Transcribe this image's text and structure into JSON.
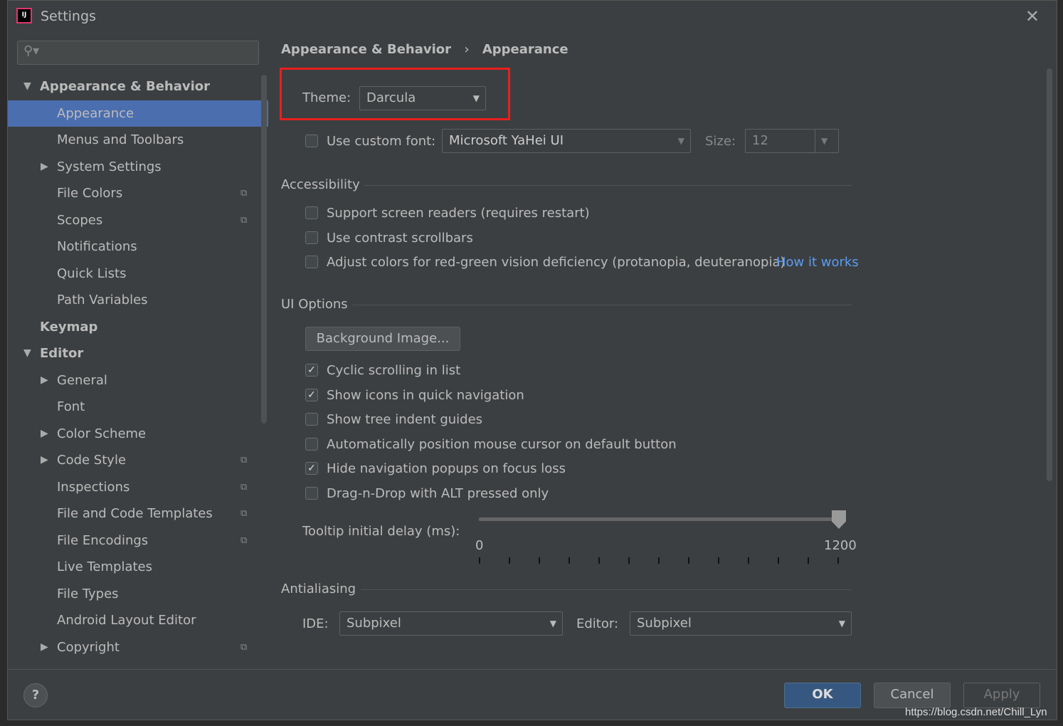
{
  "window": {
    "title": "Settings",
    "logo_text": "IJ",
    "close_icon": "close-icon"
  },
  "sidebar": {
    "search_placeholder": "",
    "items": [
      {
        "label": "Appearance & Behavior",
        "level": 0,
        "bold": true,
        "expanded": true
      },
      {
        "label": "Appearance",
        "level": 1,
        "selected": true
      },
      {
        "label": "Menus and Toolbars",
        "level": 1
      },
      {
        "label": "System Settings",
        "level": 1,
        "collapsed": true
      },
      {
        "label": "File Colors",
        "level": 1,
        "copy": true
      },
      {
        "label": "Scopes",
        "level": 1,
        "copy": true
      },
      {
        "label": "Notifications",
        "level": 1
      },
      {
        "label": "Quick Lists",
        "level": 1
      },
      {
        "label": "Path Variables",
        "level": 1
      },
      {
        "label": "Keymap",
        "level": 0,
        "bold": true
      },
      {
        "label": "Editor",
        "level": 0,
        "bold": true,
        "expanded": true
      },
      {
        "label": "General",
        "level": 1,
        "collapsed": true
      },
      {
        "label": "Font",
        "level": 1
      },
      {
        "label": "Color Scheme",
        "level": 1,
        "collapsed": true
      },
      {
        "label": "Code Style",
        "level": 1,
        "collapsed": true,
        "copy": true
      },
      {
        "label": "Inspections",
        "level": 1,
        "copy": true
      },
      {
        "label": "File and Code Templates",
        "level": 1,
        "copy": true
      },
      {
        "label": "File Encodings",
        "level": 1,
        "copy": true
      },
      {
        "label": "Live Templates",
        "level": 1
      },
      {
        "label": "File Types",
        "level": 1
      },
      {
        "label": "Android Layout Editor",
        "level": 1
      },
      {
        "label": "Copyright",
        "level": 1,
        "collapsed": true,
        "copy": true
      }
    ]
  },
  "breadcrumb": {
    "parent": "Appearance & Behavior",
    "sep": "›",
    "current": "Appearance"
  },
  "theme": {
    "label": "Theme:",
    "value": "Darcula"
  },
  "font": {
    "label": "Use custom font:",
    "checked": false,
    "value": "Microsoft YaHei UI",
    "size_label": "Size:",
    "size": "12"
  },
  "accessibility": {
    "title": "Accessibility",
    "options": [
      {
        "label": "Support screen readers (requires restart)",
        "checked": false
      },
      {
        "label": "Use contrast scrollbars",
        "checked": false
      },
      {
        "label": "Adjust colors for red-green vision deficiency (protanopia, deuteranopia)",
        "checked": false
      }
    ],
    "link": "How it works"
  },
  "ui_options": {
    "title": "UI Options",
    "bg_button": "Background Image...",
    "options": [
      {
        "label": "Cyclic scrolling in list",
        "checked": true
      },
      {
        "label": "Show icons in quick navigation",
        "checked": true
      },
      {
        "label": "Show tree indent guides",
        "checked": false
      },
      {
        "label": "Automatically position mouse cursor on default button",
        "checked": false
      },
      {
        "label": "Hide navigation popups on focus loss",
        "checked": true
      },
      {
        "label": "Drag-n-Drop with ALT pressed only",
        "checked": false
      }
    ],
    "tooltip": {
      "label": "Tooltip initial delay (ms):",
      "min": "0",
      "max": "1200",
      "value": 1200
    }
  },
  "antialiasing": {
    "title": "Antialiasing",
    "ide_label": "IDE:",
    "ide_value": "Subpixel",
    "editor_label": "Editor:",
    "editor_value": "Subpixel"
  },
  "footer": {
    "help": "?",
    "ok": "OK",
    "cancel": "Cancel",
    "apply": "Apply"
  },
  "watermark": "https://blog.csdn.net/Chill_Lyn",
  "colors": {
    "selection": "#4b6eaf",
    "link": "#589df6",
    "highlight_box": "#e8201d",
    "ok": "#365880"
  }
}
